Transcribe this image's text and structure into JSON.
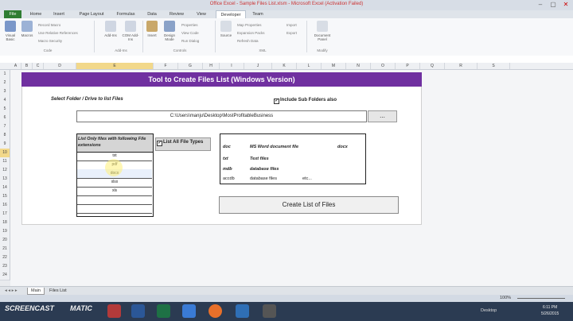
{
  "window": {
    "title": "Office Excel - Sample Files List.xlsm - Microsoft Excel (Activation Failed)",
    "controls": [
      "–",
      "▢",
      "✕"
    ]
  },
  "ribbon": {
    "tabs": [
      "File",
      "Home",
      "Insert",
      "Page Layout",
      "Formulas",
      "Data",
      "Review",
      "View",
      "Developer",
      "Team"
    ],
    "active_tab": "Developer",
    "code_group": {
      "visual_basic": "Visual Basic",
      "macros": "Macros",
      "record_macro": "Record Macro",
      "relative_refs": "Use Relative References",
      "macro_security": "Macro Security",
      "label": "Code"
    },
    "addins_group": {
      "addins": "Add-Ins",
      "com_addins": "COM Add-Ins",
      "label": "Add-Ins"
    },
    "controls_group": {
      "insert": "Insert",
      "design_mode": "Design Mode",
      "properties": "Properties",
      "view_code": "View Code",
      "run_dialog": "Run Dialog",
      "label": "Controls"
    },
    "xml_group": {
      "source": "Source",
      "map_properties": "Map Properties",
      "expansion_packs": "Expansion Packs",
      "refresh_data": "Refresh Data",
      "import": "Import",
      "export": "Export",
      "label": "XML"
    },
    "modify_group": {
      "document_panel": "Document Panel",
      "label": "Modify"
    }
  },
  "grid": {
    "columns": [
      "A",
      "B",
      "C",
      "D",
      "E",
      "F",
      "G",
      "H",
      "I",
      "J",
      "K",
      "L",
      "M",
      "N",
      "O",
      "P",
      "Q",
      "R",
      "S"
    ],
    "selected_column": "E",
    "rows": [
      "1",
      "2",
      "3",
      "4",
      "5",
      "6",
      "7",
      "8",
      "9",
      "10",
      "11",
      "12",
      "13",
      "14",
      "15",
      "16",
      "17",
      "18",
      "19",
      "20",
      "21",
      "22",
      "23",
      "24"
    ],
    "selected_row": "10"
  },
  "tool": {
    "banner": "Tool to Create Files List (Windows Version)",
    "select_folder_label": "Select Folder / Drive to list Files",
    "include_subfolders_label": "Include Sub Folders also",
    "include_subfolders_checked": "✔",
    "path_value": "C:\\Users\\manju\\Desktop\\MostProfitableBusiness",
    "browse_label": "...",
    "ext_header": "List Only files with following File extensions",
    "extensions": [
      "txt",
      "pdf",
      "docx",
      "xlsx",
      "xls",
      "",
      ""
    ],
    "list_all_label": "List All File Types",
    "list_all_checked": "✔",
    "file_types": [
      {
        "ext": "doc",
        "desc": "MS Word document file",
        "extra": "docx"
      },
      {
        "ext": "txt",
        "desc": "Text files",
        "extra": ""
      },
      {
        "ext": "mdb",
        "desc": "database files",
        "extra": ""
      },
      {
        "ext": "accdb",
        "desc": "database files",
        "extra": "etc..."
      }
    ],
    "create_button": "Create List of Files"
  },
  "sheet_tabs": [
    "Main",
    "Files List"
  ],
  "active_sheet": "Main",
  "status": {
    "zoom": "100%"
  },
  "taskbar": {
    "watermark": "SCREENCAST",
    "watermark2": "MATIC",
    "clock": "6:11 PM",
    "date": "5/26/2015",
    "desktop": "Desktop"
  }
}
